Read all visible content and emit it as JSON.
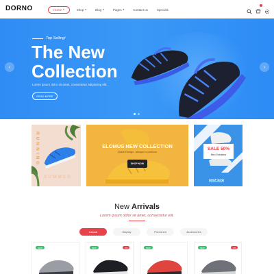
{
  "brand": {
    "logo": "DORNO"
  },
  "nav": {
    "items": [
      {
        "label": "Home",
        "has_dropdown": true,
        "active": true
      },
      {
        "label": "Shop",
        "has_dropdown": true
      },
      {
        "label": "Blog",
        "has_dropdown": true
      },
      {
        "label": "Pages",
        "has_dropdown": true
      },
      {
        "label": "Contact us"
      },
      {
        "label": "Specials"
      }
    ],
    "icons": [
      "search-icon",
      "cart-icon",
      "settings-icon"
    ]
  },
  "hero": {
    "tag": "Top Selling!",
    "title": "The New Collection",
    "description": "Lorem ipsum dolor sit amet, consectetur adipiscing elit.",
    "button": "READ MORE",
    "slides_total": 2,
    "active_slide": 1
  },
  "banners": {
    "left": {
      "title": "RUNNING",
      "subtitle": "SUMMER"
    },
    "center": {
      "title": "ELOMUS NEW COLLECTION",
      "description": "Quick Design, always to perform",
      "button": "SHOP NOW"
    },
    "right": {
      "sale": "SALE 50%",
      "subtitle": "Men Sneakers",
      "button": "SHOP NOW"
    }
  },
  "arrivals": {
    "title_light": "New ",
    "title_bold": "Arrivals",
    "description": "Lorem ipsum dolor sit amet, consectetur elit.",
    "tabs": [
      {
        "label": "Casual",
        "active": true
      },
      {
        "label": "Display"
      },
      {
        "label": "Preowned"
      },
      {
        "label": "Accessories"
      }
    ],
    "products": [
      {
        "badge_left": "NEW",
        "badge_right": ""
      },
      {
        "badge_left": "NEW",
        "badge_right": "-9%"
      },
      {
        "badge_left": "NEW",
        "badge_right": ""
      },
      {
        "badge_left": "NEW",
        "badge_right": "-9%"
      }
    ]
  },
  "colors": {
    "accent": "#e8424a",
    "hero_blue": "#3090f5",
    "new_green": "#39c16c",
    "banner_yellow": "#f2b53f",
    "banner_blue": "#3a93e6"
  }
}
